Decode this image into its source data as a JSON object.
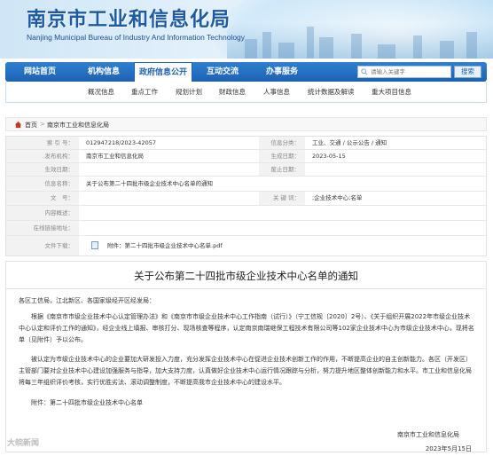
{
  "header": {
    "title": "南京市工业和信息化局",
    "subtitle": "Nanjing Municipal Bureau of Industry And Information Technology"
  },
  "nav": {
    "items": [
      {
        "label": "网站首页"
      },
      {
        "label": "机构信息"
      },
      {
        "label": "政府信息公开",
        "active": true
      },
      {
        "label": "互动交流"
      },
      {
        "label": "办事服务"
      }
    ],
    "search_placeholder": "请输入关键字",
    "search_button": "搜索"
  },
  "subnav": {
    "items": [
      "概况信息",
      "重点工作",
      "规划计划",
      "财政信息",
      "人事信息",
      "统计数据及解读",
      "重大项目信息"
    ]
  },
  "breadcrumb": {
    "home": "首页",
    "current": "南京市工业和信息化局"
  },
  "meta": {
    "index_label": "索 引 号：",
    "index_value": "012947218/2023-42057",
    "category_label": "信息分类：",
    "category_value": "工业、交通 / 公示公告 / 通知",
    "publisher_label": "发布机构：",
    "publisher_value": "南京市工业和信息化局",
    "date_label": "生成日期：",
    "date_value": "2023-05-15",
    "effective_label": "生效日期：",
    "effective_value": "",
    "repeal_label": "废止日期：",
    "repeal_value": "",
    "name_label": "信息名称：",
    "name_value": "关于公布第二十四批市级企业技术中心名单的通知",
    "docno_label": "文　号：",
    "docno_value": "",
    "keywords_label": "关 键 词：",
    "keywords_value": ";企业技术中心;名单",
    "content_label": "内容概述：",
    "content_value": "",
    "online_label": "在线链接地址：",
    "online_value": "",
    "download_label": "文件下载：",
    "download_value": "附件：第二十四批市级企业技术中心名单.pdf"
  },
  "article": {
    "title": "关于公布第二十四批市级企业技术中心名单的通知",
    "salutation": "各区工信局，江北新区、各国家级经开区经发局：",
    "p1": "根据《南京市市级企业技术中心认定管理办法》和《南京市市级企业技术中心工作指南（试行）》（宁工信规〔2020〕2号）、《关于组织开展2022年市级企业技术中心认定和评价工作的通知》，经企业线上填报、审核打分、现场核查等程序，认定南京南瑞继保工程技术有限公司等102家企业技术中心为市级企业技术中心，现将名单（见附件）予以公布。",
    "p2": "被认定为市级企业技术中心的企业要加大研发投入力度，充分发挥企业技术中心在促进企业技术创新工作的作用，不断提高企业的自主创新能力。各区（开发区）主管部门要对企业技术中心建设加强服务与指导，加大支持力度，认真做好企业技术中心运行情况跟踪与分析，努力提升地区整体创新能力和水平。市工业和信息化局将每三年组织评价考核，实行优胜劣汰、滚动调整制度，不断提高我市企业技术中心的建设水平。",
    "attachment": "附件：第二十四批市级企业技术中心名单",
    "sign_org": "南京市工业和信息化局",
    "sign_date": "2023年5月15日"
  },
  "watermark": "大皖新闻"
}
